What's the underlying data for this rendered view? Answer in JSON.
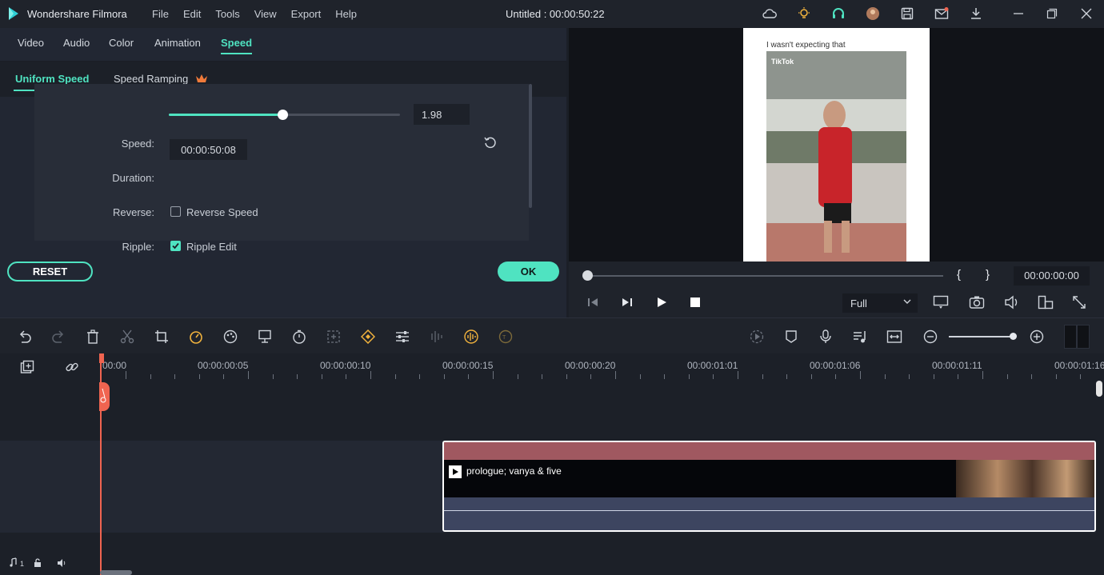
{
  "app": {
    "name": "Wondershare Filmora",
    "menus": [
      "File",
      "Edit",
      "Tools",
      "View",
      "Export",
      "Help"
    ],
    "window_title": "Untitled : 00:00:50:22"
  },
  "panel": {
    "tabs": [
      "Video",
      "Audio",
      "Color",
      "Animation",
      "Speed"
    ],
    "active_tab": "Speed",
    "subtabs": [
      "Uniform Speed",
      "Speed Ramping"
    ],
    "active_subtab": "Uniform Speed",
    "speed": {
      "label": "Speed:",
      "value": "1.98",
      "slider_fraction": 0.49
    },
    "duration": {
      "label": "Duration:",
      "value": "00:00:50:08"
    },
    "reverse": {
      "label": "Reverse:",
      "checkbox_label": "Reverse Speed",
      "checked": false
    },
    "ripple": {
      "label": "Ripple:",
      "checkbox_label": "Ripple Edit",
      "checked": true
    },
    "reset_label": "RESET",
    "ok_label": "OK"
  },
  "preview": {
    "caption": "I wasn't expecting that",
    "watermark": "TikTok",
    "braces": [
      "{",
      "}"
    ],
    "timecode": "00:00:00:00",
    "quality": "Full"
  },
  "timeline": {
    "ruler_labels": [
      "00:00",
      "00:00:00:05",
      "00:00:00:10",
      "00:00:00:15",
      "00:00:00:20",
      "00:00:01:01",
      "00:00:01:06",
      "00:00:01:11",
      "00:00:01:16"
    ],
    "clip_title": "prologue; vanya & five",
    "video_track_label": "1",
    "audio_track_label": "1"
  },
  "colors": {
    "accent": "#4fe3c1",
    "playhead": "#f06450",
    "clip_header": "#a05860"
  }
}
